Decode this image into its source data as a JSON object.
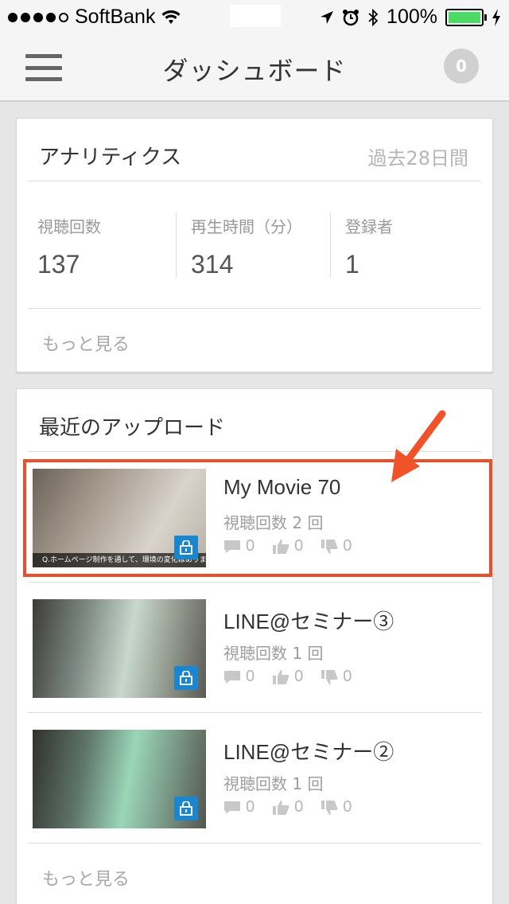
{
  "status_bar": {
    "carrier": "SoftBank",
    "battery_percent": "100%"
  },
  "header": {
    "title": "ダッシュボード",
    "notification_count": "0"
  },
  "analytics": {
    "title": "アナリティクス",
    "period": "過去28日間",
    "stats": [
      {
        "label": "視聴回数",
        "value": "137"
      },
      {
        "label": "再生時間（分）",
        "value": "314"
      },
      {
        "label": "登録者",
        "value": "1"
      }
    ],
    "more_label": "もっと見る"
  },
  "uploads": {
    "title": "最近のアップロード",
    "videos": [
      {
        "title": "My Movie 70",
        "views": "視聴回数 2 回",
        "comments": "0",
        "likes": "0",
        "dislikes": "0",
        "caption": "Q.ホームページ制作を通して、環境の変化はありましたか?"
      },
      {
        "title": "LINE@セミナー③",
        "views": "視聴回数 1 回",
        "comments": "0",
        "likes": "0",
        "dislikes": "0"
      },
      {
        "title": "LINE@セミナー②",
        "views": "視聴回数 1 回",
        "comments": "0",
        "likes": "0",
        "dislikes": "0"
      }
    ],
    "more_label": "もっと見る"
  },
  "colors": {
    "highlight": "#e8502c",
    "lock_badge": "#1a86d0",
    "battery": "#4cd964"
  }
}
